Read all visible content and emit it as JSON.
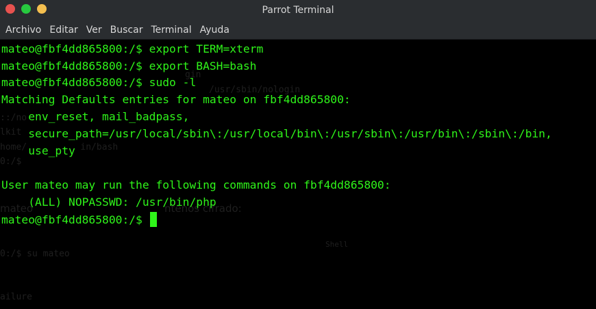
{
  "window": {
    "title": "Parrot Terminal",
    "colors": {
      "close": "#e8524f",
      "minimize": "#27c93f",
      "maximize": "#f4bf4f",
      "terminal_text": "#2ff51a",
      "background": "#000000",
      "chrome": "#2a2d30"
    }
  },
  "menu": {
    "items": [
      "Archivo",
      "Editar",
      "Ver",
      "Buscar",
      "Terminal",
      "Ayuda"
    ]
  },
  "terminal": {
    "lines": [
      "mateo@fbf4dd865800:/$ export TERM=xterm",
      "mateo@fbf4dd865800:/$ export BASH=bash",
      "mateo@fbf4dd865800:/$ sudo -l",
      "Matching Defaults entries for mateo on fbf4dd865800:",
      "    env_reset, mail_badpass,",
      "    secure_path=/usr/local/sbin\\:/usr/local/bin\\:/usr/sbin\\:/usr/bin\\:/sbin\\:/bin,",
      "    use_pty",
      "",
      "User mateo may run the following commands on fbf4dd865800:",
      "    (ALL) NOPASSWD: /usr/bin/php",
      "mateo@fbf4dd865800:/$ "
    ],
    "ghost_text": [
      "gin",
      "/usr/sbin/nologin",
      "::/no",
      "lkit",
      "home/          in/bash",
      "0:/$",
      "mateo",
      "ntenos cifrado:",
      "Shell",
      "0:/$ su mateo",
      "ailure"
    ]
  }
}
